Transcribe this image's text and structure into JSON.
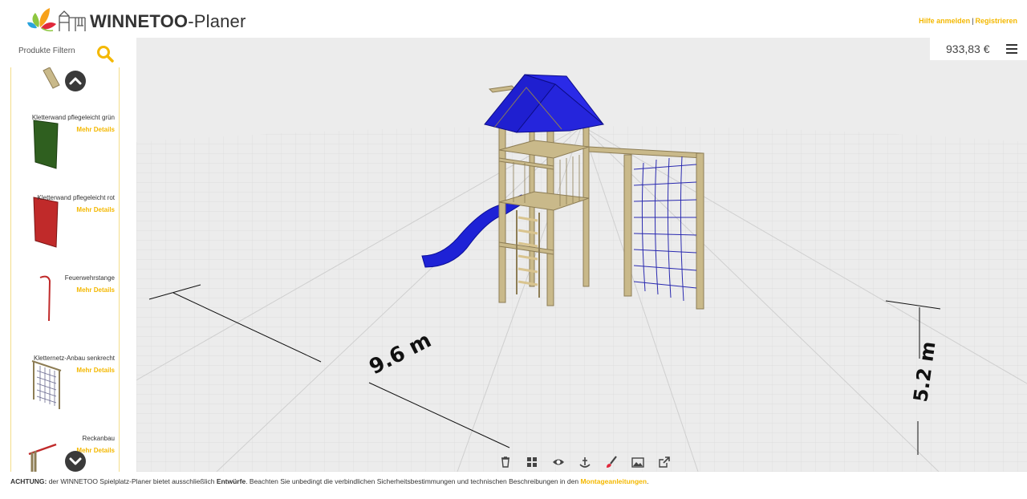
{
  "header": {
    "brand_bold": "WINNETOO",
    "brand_rest": "-Planer",
    "login": "Hilfe anmelden",
    "separator": "|",
    "register": "Registrieren"
  },
  "sidebar": {
    "filter_label": "Produkte Filtern",
    "products": [
      {
        "name": "Kletterwand pflegeleicht grün",
        "more": "Mehr Details"
      },
      {
        "name": "Kletterwand pflegeleicht rot",
        "more": "Mehr Details"
      },
      {
        "name": "Feuerwehrstange",
        "more": "Mehr Details"
      },
      {
        "name": "Kletternetz-Anbau senkrecht",
        "more": "Mehr Details"
      },
      {
        "name": "Reckanbau",
        "more": "Mehr Details"
      }
    ]
  },
  "viewport": {
    "price": "933,83 €",
    "dimension_width": "9.6 m",
    "dimension_depth": "5.2 m",
    "toolbar_icons": [
      "trash-icon",
      "grid-icon",
      "eye-icon",
      "anchor-icon",
      "brush-icon",
      "image-icon",
      "external-link-icon"
    ]
  },
  "footer": {
    "warning_label": "ACHTUNG:",
    "text1": " der WINNETOO Spielplatz-Planer bietet ausschließlich ",
    "bold": "Entwürfe",
    "text2": ". Beachten Sie unbedingt die verbindlichen Sicherheitsbestimmungen und technischen Beschreibungen in den ",
    "link": "Montageanleitungen",
    "text3": "."
  },
  "colors": {
    "accent": "#f4b800",
    "roof": "#2020e0",
    "wood": "#b5a57a",
    "grid_bg": "#ececec"
  }
}
